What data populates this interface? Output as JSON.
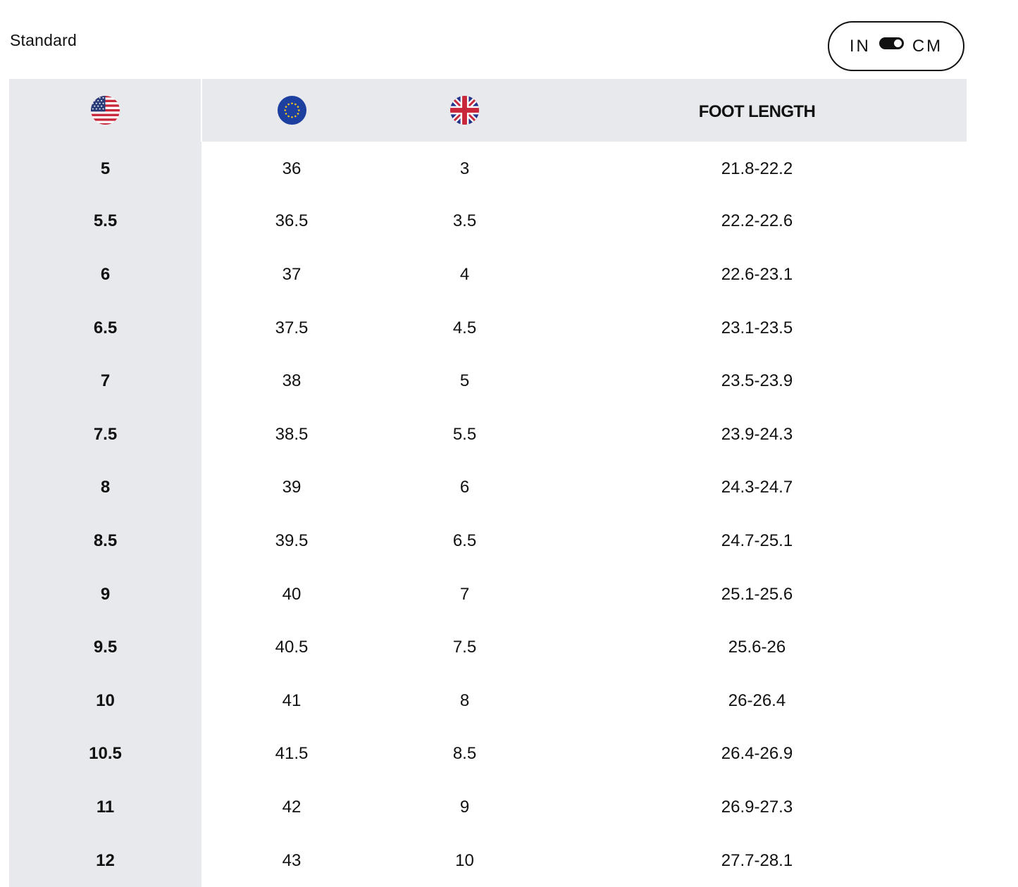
{
  "title": "Standard",
  "unit_toggle": {
    "left_label": "IN",
    "right_label": "CM",
    "selected": "CM"
  },
  "columns": {
    "us": {
      "icon": "us-flag-icon"
    },
    "eu": {
      "icon": "eu-flag-icon"
    },
    "uk": {
      "icon": "uk-flag-icon"
    },
    "length": {
      "label": "FOOT LENGTH"
    }
  },
  "rows": [
    {
      "us": "5",
      "eu": "36",
      "uk": "3",
      "length": "21.8-22.2"
    },
    {
      "us": "5.5",
      "eu": "36.5",
      "uk": "3.5",
      "length": "22.2-22.6"
    },
    {
      "us": "6",
      "eu": "37",
      "uk": "4",
      "length": "22.6-23.1"
    },
    {
      "us": "6.5",
      "eu": "37.5",
      "uk": "4.5",
      "length": "23.1-23.5"
    },
    {
      "us": "7",
      "eu": "38",
      "uk": "5",
      "length": "23.5-23.9"
    },
    {
      "us": "7.5",
      "eu": "38.5",
      "uk": "5.5",
      "length": "23.9-24.3"
    },
    {
      "us": "8",
      "eu": "39",
      "uk": "6",
      "length": "24.3-24.7"
    },
    {
      "us": "8.5",
      "eu": "39.5",
      "uk": "6.5",
      "length": "24.7-25.1"
    },
    {
      "us": "9",
      "eu": "40",
      "uk": "7",
      "length": "25.1-25.6"
    },
    {
      "us": "9.5",
      "eu": "40.5",
      "uk": "7.5",
      "length": "25.6-26"
    },
    {
      "us": "10",
      "eu": "41",
      "uk": "8",
      "length": "26-26.4"
    },
    {
      "us": "10.5",
      "eu": "41.5",
      "uk": "8.5",
      "length": "26.4-26.9"
    },
    {
      "us": "11",
      "eu": "42",
      "uk": "9",
      "length": "26.9-27.3"
    },
    {
      "us": "12",
      "eu": "43",
      "uk": "10",
      "length": "27.7-28.1"
    }
  ],
  "colors": {
    "header_bg": "#e8e9ed",
    "text": "#111111"
  }
}
